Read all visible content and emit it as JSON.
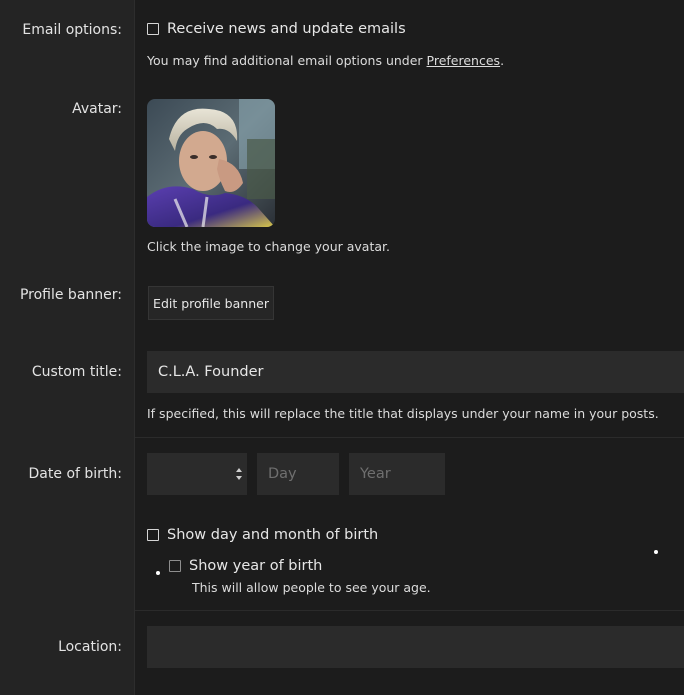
{
  "email_options": {
    "label": "Email options:",
    "checkbox_label": "Receive news and update emails",
    "hint_prefix": "You may find additional email options under ",
    "hint_link": "Preferences",
    "hint_suffix": "."
  },
  "avatar": {
    "label": "Avatar:",
    "hint": "Click the image to change your avatar."
  },
  "profile_banner": {
    "label": "Profile banner:",
    "button_label": "Edit profile banner"
  },
  "custom_title": {
    "label": "Custom title:",
    "value": "C.L.A. Founder",
    "hint": "If specified, this will replace the title that displays under your name in your posts."
  },
  "date_of_birth": {
    "label": "Date of birth:",
    "month_value": "",
    "day_placeholder": "Day",
    "year_placeholder": "Year",
    "show_day_month_label": "Show day and month of birth",
    "show_year_label": "Show year of birth",
    "show_year_hint": "This will allow people to see your age."
  },
  "location": {
    "label": "Location:",
    "value": ""
  },
  "colors": {
    "background": "#1c1c1c",
    "label_column": "#242424",
    "input_background": "#2b2b2b",
    "text": "#e6e6e6"
  }
}
